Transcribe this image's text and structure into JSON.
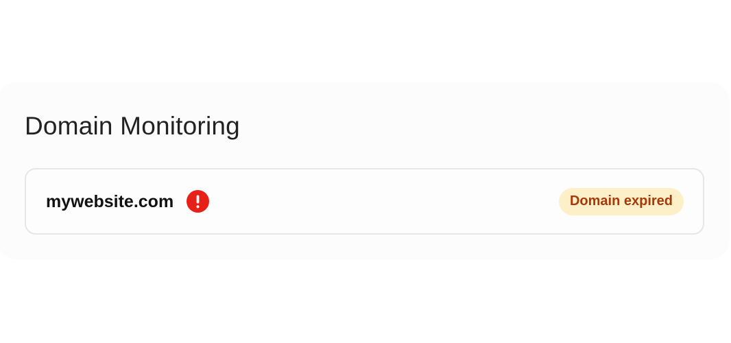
{
  "section": {
    "title": "Domain Monitoring"
  },
  "domains": [
    {
      "name": "mywebsite.com",
      "alert_icon": "exclamation-circle-icon",
      "status": "Domain expired",
      "colors": {
        "alert": "#e62117",
        "badge_background": "#fdefc8",
        "badge_text": "#a5390a"
      }
    }
  ]
}
